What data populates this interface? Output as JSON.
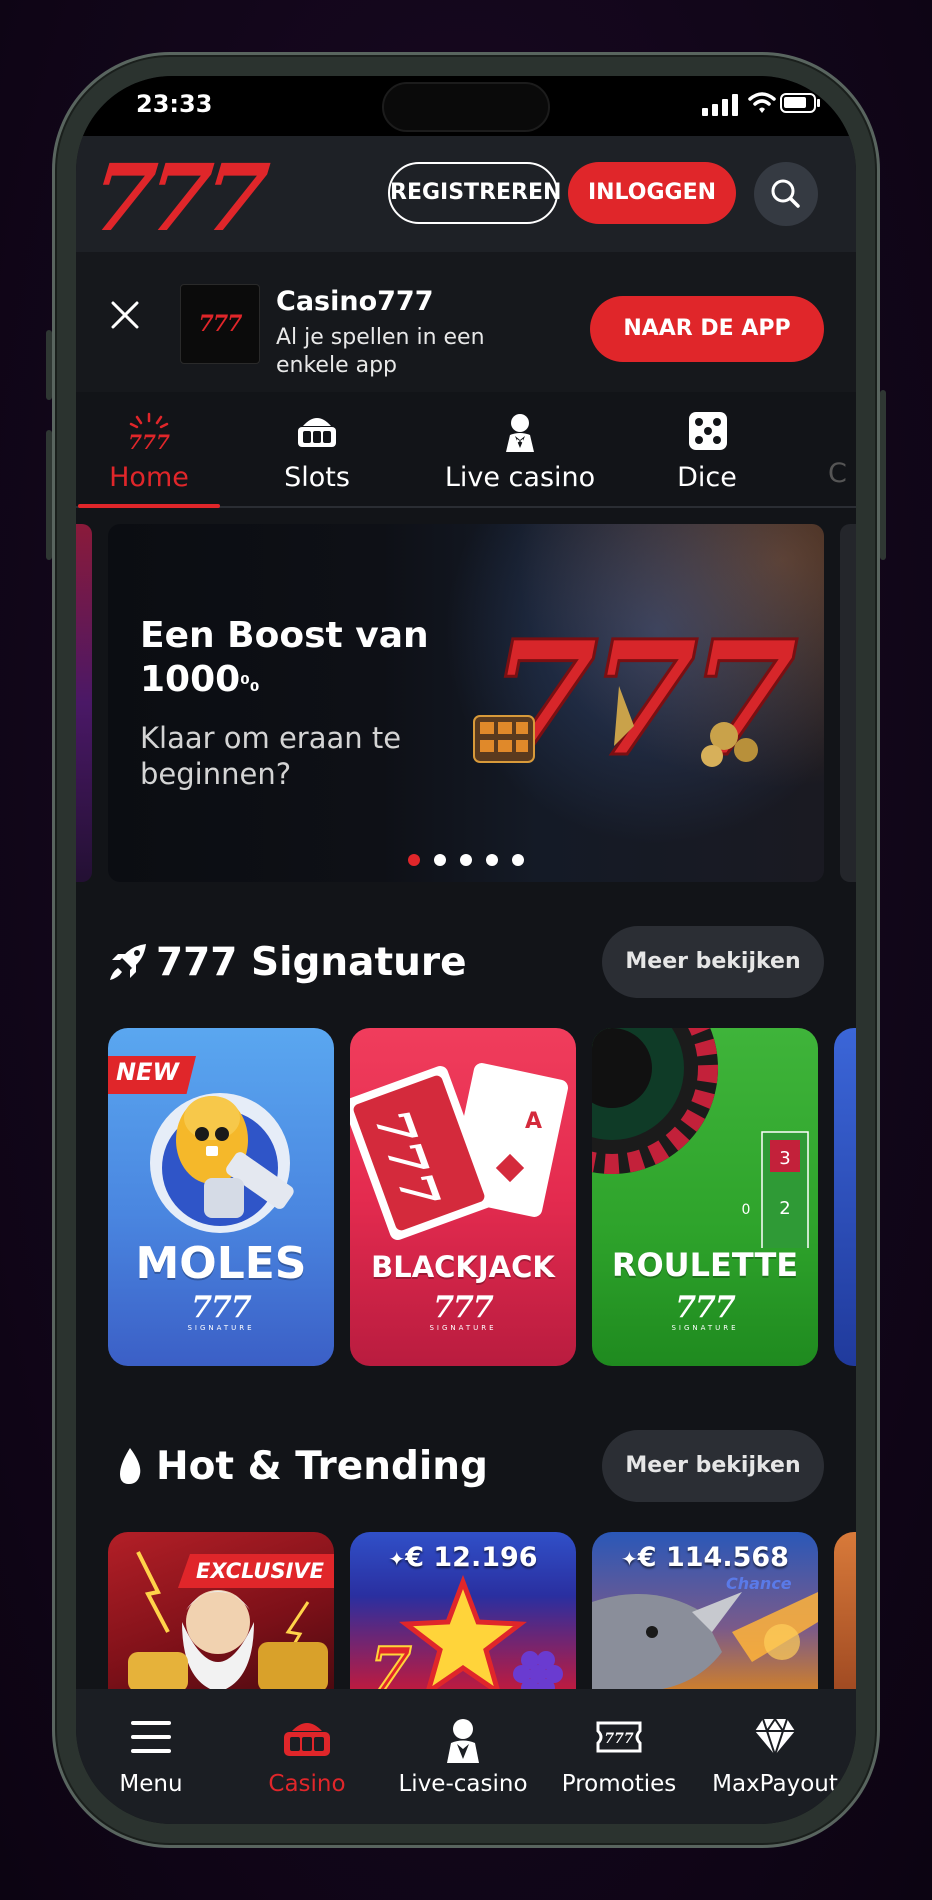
{
  "status_bar": {
    "time": "23:33"
  },
  "header": {
    "logo": "777",
    "register_label": "REGISTREREN",
    "login_label": "INLOGGEN",
    "search_icon": "search-icon"
  },
  "app_banner": {
    "icon_text": "777",
    "title": "Casino777",
    "subtitle": "Al je spellen in een enkele app",
    "button_label": "NAAR DE APP"
  },
  "tabs": [
    {
      "label": "Home",
      "icon": "home-777-icon",
      "active": true
    },
    {
      "label": "Slots",
      "icon": "slot-machine-icon"
    },
    {
      "label": "Live casino",
      "icon": "dealer-icon"
    },
    {
      "label": "Dice",
      "icon": "dice-icon"
    },
    {
      "label": "C"
    }
  ],
  "hero": {
    "title": "Een Boost van 1000",
    "title_suffix": "⁰₀",
    "subtitle": "Klaar om eraan te beginnen?",
    "art_text": "777",
    "slides": 5,
    "active_slide": 1
  },
  "signature": {
    "title": "777 Signature",
    "more_label": "Meer bekijken",
    "games": [
      {
        "name": "MOLES",
        "brand": "777",
        "sub": "SIGNATURE",
        "badge": "NEW"
      },
      {
        "name": "BLACKJACK",
        "brand": "777",
        "sub": "SIGNATURE"
      },
      {
        "name": "ROULETTE",
        "brand": "777",
        "sub": "SIGNATURE"
      }
    ]
  },
  "trending": {
    "title": "Hot & Trending",
    "more_label": "Meer bekijken",
    "games": [
      {
        "badge": "EXCLUSIVE"
      },
      {
        "jackpot": "€ 12.196"
      },
      {
        "jackpot": "€ 114.568",
        "tag": "Chance"
      }
    ]
  },
  "bottom_nav": [
    {
      "label": "Menu",
      "icon": "hamburger-icon"
    },
    {
      "label": "Casino",
      "icon": "slot-machine-icon",
      "active": true
    },
    {
      "label": "Live-casino",
      "icon": "dealer-icon"
    },
    {
      "label": "Promoties",
      "icon": "ticket-icon"
    },
    {
      "label": "MaxPayout",
      "icon": "diamond-icon"
    }
  ],
  "colors": {
    "accent": "#e0262a",
    "background": "#121418",
    "header": "#1e2126"
  }
}
